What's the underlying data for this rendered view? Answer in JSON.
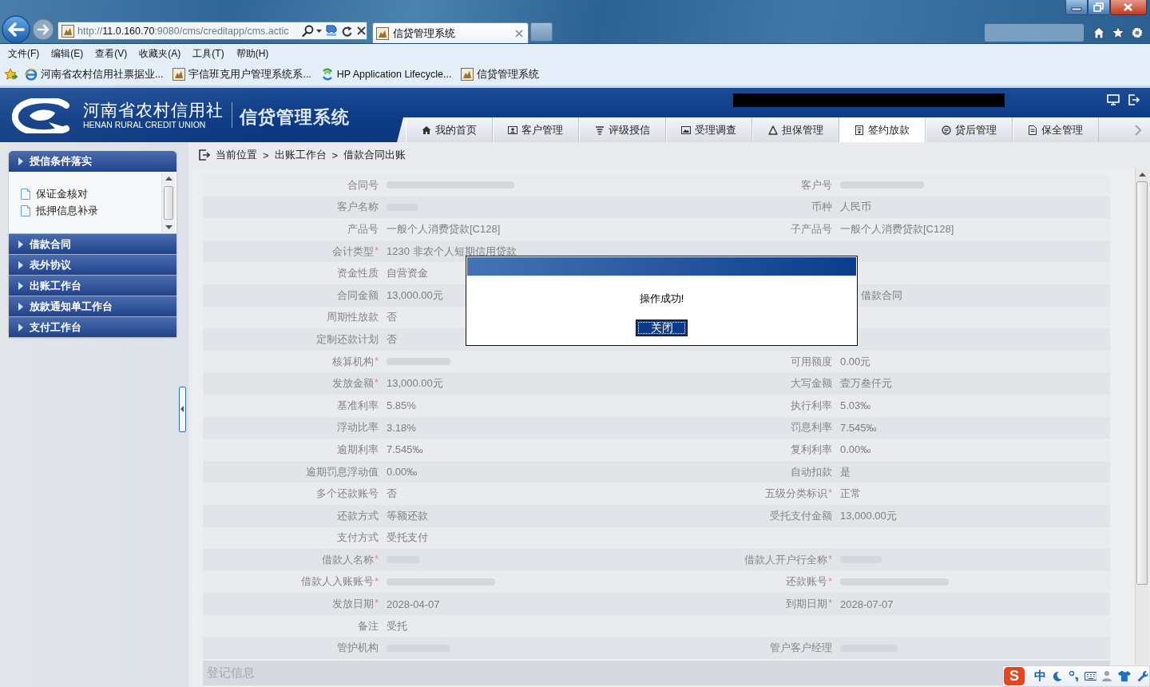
{
  "browser": {
    "address": {
      "scheme": "http://",
      "host": "11.0.160.70",
      "path": ":9080/cms/creditapp/cms.actic"
    },
    "tabs": [
      {
        "title": "信贷管理系统",
        "selected": true
      }
    ],
    "menu": [
      "文件(F)",
      "编辑(E)",
      "查看(V)",
      "收藏夹(A)",
      "工具(T)",
      "帮助(H)"
    ],
    "favorites": [
      {
        "label": "河南省农村信用社票据业..."
      },
      {
        "label": "宇信班克用户管理系统系..."
      },
      {
        "label": "HP Application Lifecycle..."
      },
      {
        "label": "信贷管理系统"
      }
    ]
  },
  "header": {
    "org_name": "河南省农村信用社",
    "org_name_en": "HENAN RURAL CREDIT UNION",
    "system_name": "信贷管理系统"
  },
  "nav_tabs": [
    {
      "label": "我的首页",
      "selected": false
    },
    {
      "label": "客户管理",
      "selected": false
    },
    {
      "label": "评级授信",
      "selected": false
    },
    {
      "label": "受理调查",
      "selected": false
    },
    {
      "label": "担保管理",
      "selected": false
    },
    {
      "label": "签约放款",
      "selected": true
    },
    {
      "label": "贷后管理",
      "selected": false
    },
    {
      "label": "保全管理",
      "selected": false
    }
  ],
  "sidebar": {
    "sections": [
      {
        "title": "授信条件落实",
        "items": [
          {
            "label": "保证金核对"
          },
          {
            "label": "抵押信息补录"
          }
        ]
      },
      {
        "title": "借款合同"
      },
      {
        "title": "表外协议"
      },
      {
        "title": "出账工作台"
      },
      {
        "title": "放款通知单工作台"
      },
      {
        "title": "支付工作台"
      }
    ]
  },
  "breadcrumb": [
    {
      "text": "当前位置"
    },
    {
      "separator": ">",
      "text": "出账工作台"
    },
    {
      "separator": ">",
      "text": "借款合同出账"
    }
  ],
  "form": {
    "rows": [
      {
        "left": {
          "label": "合同号",
          "blurred": true
        },
        "right": {
          "label": "客户号",
          "blurred": true
        }
      },
      {
        "left": {
          "label": "客户名称",
          "blurred": true
        },
        "right": {
          "label": "币种",
          "value": "人民币"
        }
      },
      {
        "left": {
          "label": "产品号",
          "value": "一般个人消费贷款[C128]"
        },
        "right": {
          "label": "子产品号",
          "value": "一般个人消费贷款[C128]"
        }
      },
      {
        "left": {
          "label": "会计类型",
          "required_mark": "*",
          "value": "1230 非农个人短期信用贷款"
        }
      },
      {
        "left": {
          "label": "资金性质",
          "value": "自营资金"
        }
      },
      {
        "left": {
          "label": "合同金额",
          "value": "13,000.00元"
        },
        "right": {
          "value": "借款合同"
        }
      },
      {
        "left": {
          "label": "周期性放款",
          "value": "否"
        }
      },
      {
        "left": {
          "label": "定制还款计划",
          "value": "否"
        }
      },
      {
        "left": {
          "label": "核算机构",
          "required_mark": "*",
          "blurred": true
        },
        "right": {
          "label": "可用额度",
          "value": "0.00元"
        }
      },
      {
        "left": {
          "label": "发放金额",
          "required_mark": "*",
          "value": "13,000.00元"
        },
        "right": {
          "label": "大写金额",
          "value": "壹万叁仟元"
        }
      },
      {
        "left": {
          "label": "基准利率",
          "value": "5.85%"
        },
        "right": {
          "label": "执行利率",
          "value": "5.03‰"
        }
      },
      {
        "left": {
          "label": "浮动比率",
          "value": "3.18%"
        },
        "right": {
          "label": "罚息利率",
          "value": "7.545‰"
        }
      },
      {
        "left": {
          "label": "逾期利率",
          "value": "7.545‰"
        },
        "right": {
          "label": "复利利率",
          "value": "0.00‰"
        }
      },
      {
        "left": {
          "label": "逾期罚息浮动值",
          "value": "0.00‰"
        },
        "right": {
          "label": "自动扣款",
          "value": "是"
        }
      },
      {
        "left": {
          "label": "多个还款账号",
          "value": "否"
        },
        "right": {
          "label": "五级分类标识",
          "required_mark": "*",
          "value": "正常"
        }
      },
      {
        "left": {
          "label": "还款方式",
          "value": "等额还款"
        },
        "right": {
          "label": "受托支付金额",
          "value": "13,000.00元"
        }
      },
      {
        "left": {
          "label": "支付方式",
          "value": "受托支付"
        }
      },
      {
        "left": {
          "label": "借款人名称",
          "required_mark": "*",
          "blurred": true
        },
        "right": {
          "label": "借款人开户行全称",
          "required_mark": "*",
          "blurred": true
        }
      },
      {
        "left": {
          "label": "借款人入账账号",
          "required_mark": "*",
          "blurred": true
        },
        "right": {
          "label": "还款账号",
          "required_mark": "*",
          "blurred": true
        }
      },
      {
        "left": {
          "label": "发放日期",
          "required_mark": "*",
          "value": "2028-04-07"
        },
        "right": {
          "label": "到期日期",
          "required_mark": "*",
          "value": "2028-07-07"
        }
      },
      {
        "left": {
          "label": "备注",
          "value": "受托"
        }
      },
      {
        "left": {
          "label": "管护机构",
          "blurred": true
        },
        "right": {
          "label": "管户客户经理",
          "blurred": true
        }
      }
    ],
    "section_title": "登记信息"
  },
  "dialog": {
    "message": "操作成功!",
    "button": "关闭"
  },
  "ime_bar": {
    "logo": "S",
    "mode": "中"
  }
}
